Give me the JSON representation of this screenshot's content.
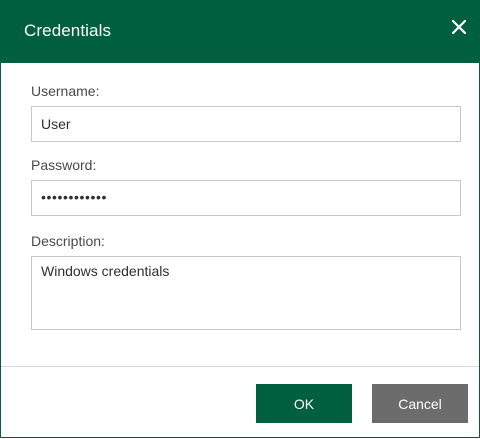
{
  "dialog": {
    "title": "Credentials",
    "close_icon": "close-icon"
  },
  "form": {
    "username": {
      "label": "Username:",
      "value": "User"
    },
    "password": {
      "label": "Password:",
      "masked_value": "••••••••••••"
    },
    "description": {
      "label": "Description:",
      "value": "Windows credentials"
    }
  },
  "buttons": {
    "ok_label": "OK",
    "cancel_label": "Cancel"
  },
  "colors": {
    "header": "#005f3e",
    "primary_button": "#005f3e",
    "secondary_button": "#6c6c6c",
    "input_border": "#c9c9c9"
  }
}
